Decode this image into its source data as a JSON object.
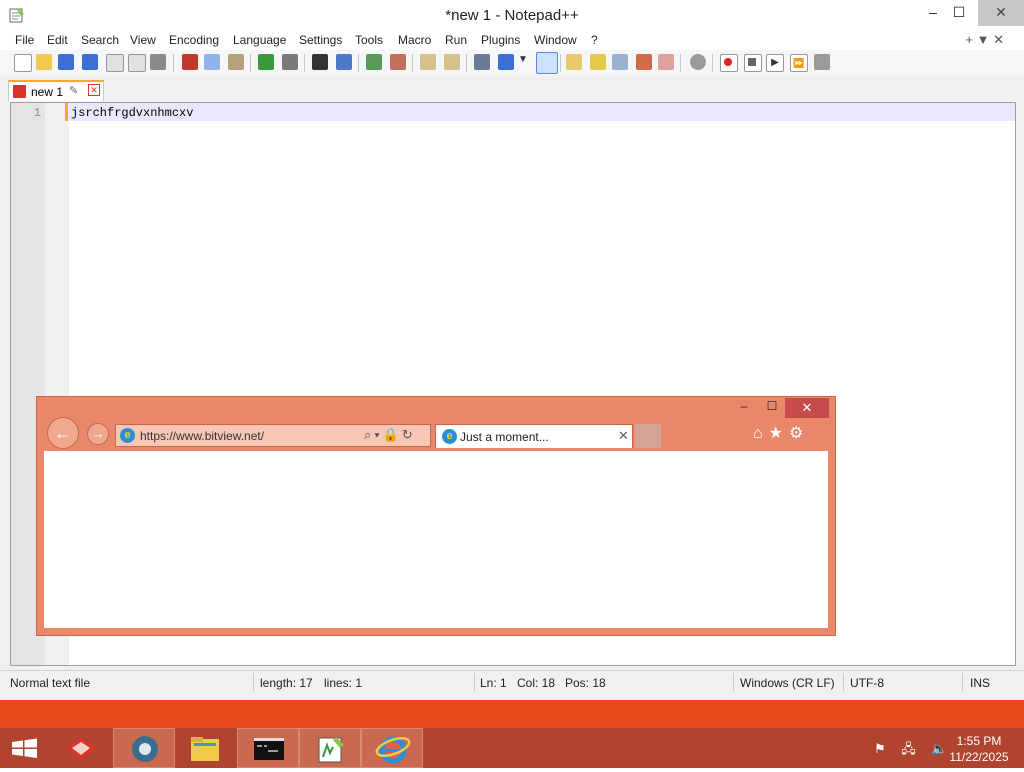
{
  "notepad": {
    "title": "*new 1 - Notepad++",
    "window_buttons": {
      "minimize": "–",
      "maximize": "☐",
      "close": "✕"
    },
    "menu": [
      "File",
      "Edit",
      "Search",
      "View",
      "Encoding",
      "Language",
      "Settings",
      "Tools",
      "Macro",
      "Run",
      "Plugins",
      "Window",
      "?"
    ],
    "menu_right": "+  ▼  ✕",
    "tab": {
      "label": "new 1",
      "pin": "✎",
      "close": "✕"
    },
    "editor": {
      "line_number": "1",
      "text": "jsrchfrgdvxnhmcxv"
    },
    "status": {
      "file_type": "Normal text file",
      "length": "length: 17",
      "lines": "lines: 1",
      "ln": "Ln: 1",
      "col": "Col: 18",
      "pos": "Pos: 18",
      "eol": "Windows (CR LF)",
      "encoding": "UTF-8",
      "mode": "INS"
    }
  },
  "browser": {
    "window_buttons": {
      "minimize": "–",
      "maximize": "☐",
      "close": "✕"
    },
    "back": "←",
    "forward": "→",
    "url": "https://www.bitview.net/",
    "address_buttons": "⌕▾🔒↻",
    "tab": {
      "label": "Just a moment...",
      "close": "✕"
    },
    "right_icons": "⌂★⚙"
  },
  "taskbar": {
    "apps": [
      "app-1",
      "chrome",
      "file-explorer",
      "command-prompt",
      "notepad-plus-plus",
      "internet-explorer"
    ],
    "tray": "⚑ 🖧 🔈",
    "time": "1:55 PM",
    "date": "11/22/2025"
  },
  "colors": {
    "accent": "#e84a1d",
    "ie_frame": "#e8876a",
    "tab_highlight": "#f4a636"
  }
}
